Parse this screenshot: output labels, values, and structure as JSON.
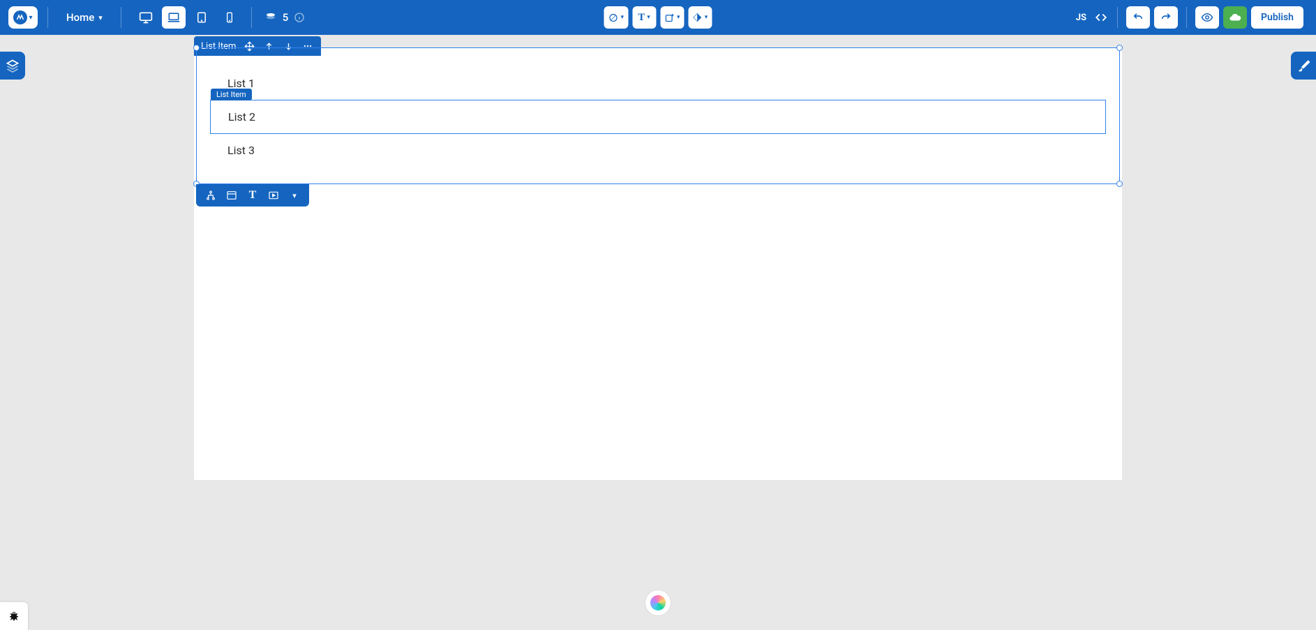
{
  "topbar": {
    "page_name": "Home",
    "counter": "5",
    "js_label": "JS",
    "publish_label": "Publish"
  },
  "context_bar": {
    "label": "List Item"
  },
  "hover_tag": "List Item",
  "list_items": [
    "List 1",
    "List 2",
    "List 3"
  ]
}
